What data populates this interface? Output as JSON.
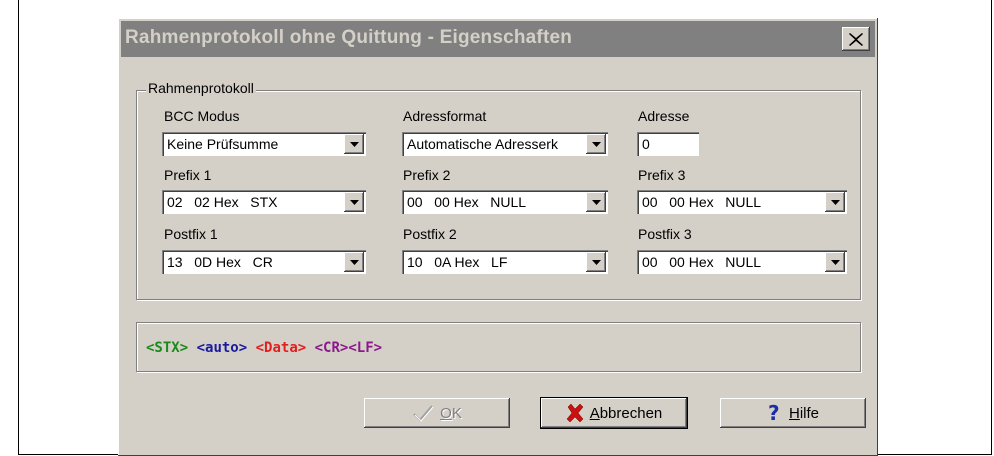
{
  "dialog": {
    "title": "Rahmenprotokoll ohne Quittung - Eigenschaften",
    "close_glyph": "✕"
  },
  "group": {
    "legend": "Rahmenprotokoll",
    "bcc": {
      "label": "BCC Modus",
      "value": "Keine Prüfsumme"
    },
    "adressformat": {
      "label": "Adressformat",
      "value": "Automatische Adresserk"
    },
    "adresse": {
      "label": "Adresse",
      "value": "0"
    },
    "prefix1": {
      "label": "Prefix 1",
      "value": "02   02 Hex   STX"
    },
    "prefix2": {
      "label": "Prefix 2",
      "value": "00   00 Hex   NULL"
    },
    "prefix3": {
      "label": "Prefix 3",
      "value": "00   00 Hex   NULL"
    },
    "postfix1": {
      "label": "Postfix 1",
      "value": "13   0D Hex   CR"
    },
    "postfix2": {
      "label": "Postfix 2",
      "value": "10   0A Hex   LF"
    },
    "postfix3": {
      "label": "Postfix 3",
      "value": "00   00 Hex   NULL"
    }
  },
  "preview": {
    "stx": "<STX>",
    "auto": "<auto>",
    "data": "<Data>",
    "crlf": "<CR><LF>",
    "colors": {
      "stx": "#1a8a1a",
      "auto": "#1a1aa0",
      "data": "#e02020",
      "crlf": "#8a1a8a"
    }
  },
  "buttons": {
    "ok": {
      "label_hotkey": "O",
      "label_rest": "K",
      "enabled": false
    },
    "cancel": {
      "label_hotkey": "A",
      "label_rest": "bbrechen"
    },
    "help": {
      "label_hotkey": "H",
      "label_rest": "ilfe"
    }
  },
  "icons": {
    "ok": "check-icon",
    "cancel": "red-x-icon",
    "help": "question-mark-icon"
  }
}
